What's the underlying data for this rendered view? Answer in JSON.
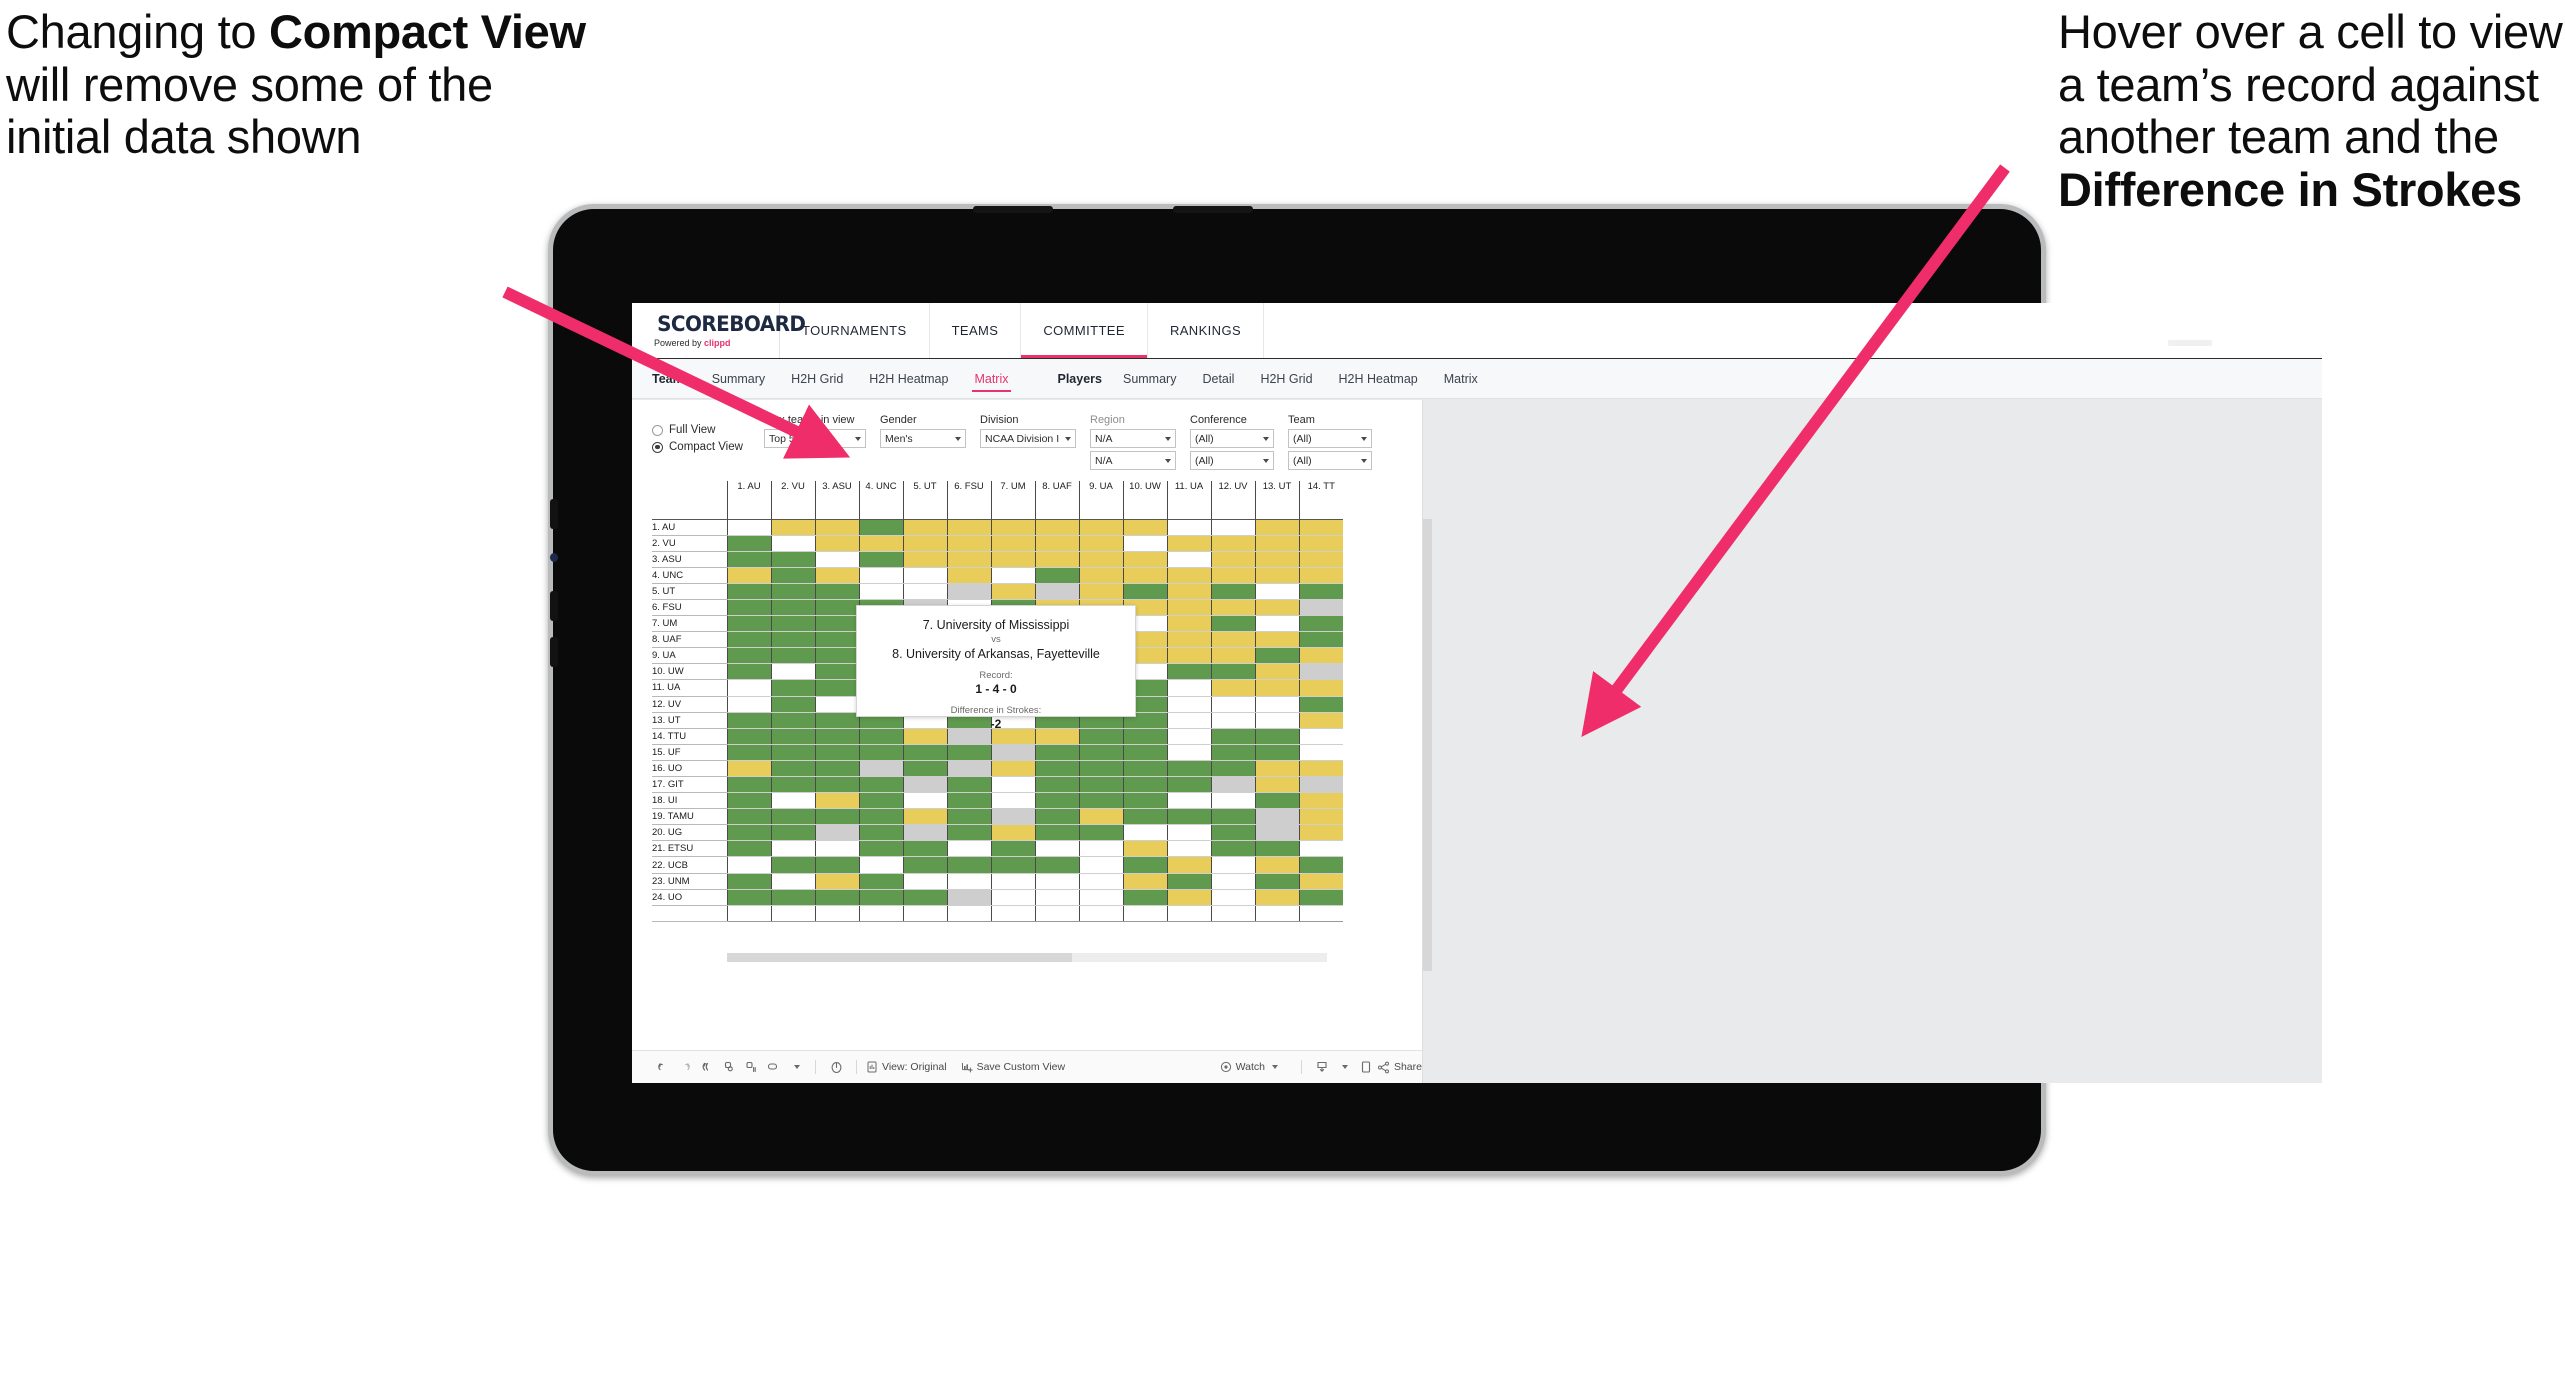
{
  "annotations": {
    "left": {
      "pre": "Changing to ",
      "bold": "Compact View",
      "post": " will remove some of the initial data shown"
    },
    "right": {
      "pre": "Hover over a cell to view a team’s record against another team and the ",
      "bold": "Difference in Strokes",
      "post": ""
    }
  },
  "app": {
    "logo": {
      "title": "SCOREBOARD",
      "sub_pre": "Powered by ",
      "sub_brand": "clippd"
    },
    "nav": [
      {
        "label": "TOURNAMENTS",
        "active": false
      },
      {
        "label": "TEAMS",
        "active": false
      },
      {
        "label": "COMMITTEE",
        "active": true
      },
      {
        "label": "RANKINGS",
        "active": false
      }
    ],
    "subnav": {
      "teams_group_label": "Teams",
      "teams_items": [
        {
          "label": "Summary",
          "active": false
        },
        {
          "label": "H2H Grid",
          "active": false
        },
        {
          "label": "H2H Heatmap",
          "active": false
        },
        {
          "label": "Matrix",
          "active": true
        }
      ],
      "players_group_label": "Players",
      "players_items": [
        {
          "label": "Summary",
          "active": false
        },
        {
          "label": "Detail",
          "active": false
        },
        {
          "label": "H2H Grid",
          "active": false
        },
        {
          "label": "H2H Heatmap",
          "active": false
        },
        {
          "label": "Matrix",
          "active": false
        }
      ]
    }
  },
  "filters": {
    "view_mode": [
      {
        "label": "Full View",
        "selected": false
      },
      {
        "label": "Compact View",
        "selected": true
      }
    ],
    "selects": [
      {
        "label": "Max teams in view",
        "value": "Top 50",
        "dim": false,
        "width": "w-max"
      },
      {
        "label": "Gender",
        "value": "Men's",
        "dim": false,
        "width": "w-gen"
      },
      {
        "label": "Division",
        "value": "NCAA Division I",
        "dim": false,
        "width": "w-div"
      },
      {
        "label": "Region",
        "value": "N/A",
        "value2": "N/A",
        "dim": true,
        "width": "w-reg"
      },
      {
        "label": "Conference",
        "value": "(All)",
        "value2": "(All)",
        "dim": false,
        "width": "w-con"
      },
      {
        "label": "Team",
        "value": "(All)",
        "value2": "(All)",
        "dim": false,
        "width": "w-tea"
      }
    ]
  },
  "matrix": {
    "columns": [
      "1. AU",
      "2. VU",
      "3. ASU",
      "4. UNC",
      "5. UT",
      "6. FSU",
      "7. UM",
      "8. UAF",
      "9. UA",
      "10. UW",
      "11. UA",
      "12. UV",
      "13. UT",
      "14. TT"
    ],
    "rows": [
      {
        "label": "1. AU",
        "cells": [
          "w",
          "y",
          "y",
          "g",
          "y",
          "y",
          "y",
          "y",
          "y",
          "y",
          "w",
          "w",
          "y",
          "y"
        ]
      },
      {
        "label": "2. VU",
        "cells": [
          "g",
          "w",
          "y",
          "y",
          "y",
          "y",
          "y",
          "y",
          "y",
          "w",
          "y",
          "y",
          "y",
          "y"
        ]
      },
      {
        "label": "3. ASU",
        "cells": [
          "g",
          "g",
          "w",
          "g",
          "y",
          "y",
          "y",
          "y",
          "y",
          "y",
          "w",
          "y",
          "y",
          "y"
        ]
      },
      {
        "label": "4. UNC",
        "cells": [
          "y",
          "g",
          "y",
          "w",
          "w",
          "y",
          "w",
          "g",
          "y",
          "y",
          "y",
          "y",
          "y",
          "y"
        ]
      },
      {
        "label": "5. UT",
        "cells": [
          "g",
          "g",
          "g",
          "w",
          "w",
          "s",
          "y",
          "s",
          "y",
          "g",
          "y",
          "g",
          "w",
          "g"
        ]
      },
      {
        "label": "6. FSU",
        "cells": [
          "g",
          "g",
          "g",
          "g",
          "s",
          "w",
          "g",
          "y",
          "y",
          "y",
          "y",
          "y",
          "y",
          "s"
        ]
      },
      {
        "label": "7. UM",
        "cells": [
          "g",
          "g",
          "g",
          "w",
          "g",
          "y",
          "w",
          "g",
          "y",
          "w",
          "y",
          "g",
          "w",
          "g"
        ]
      },
      {
        "label": "8. UAF",
        "cells": [
          "g",
          "g",
          "g",
          "y",
          "s",
          "g",
          "y",
          "w",
          "y",
          "y",
          "y",
          "y",
          "y",
          "g"
        ]
      },
      {
        "label": "9. UA",
        "cells": [
          "g",
          "g",
          "g",
          "g",
          "g",
          "g",
          "g",
          "g",
          "w",
          "y",
          "y",
          "y",
          "g",
          "y"
        ]
      },
      {
        "label": "10. UW",
        "cells": [
          "g",
          "w",
          "g",
          "g",
          "y",
          "y",
          "w",
          "g",
          "y",
          "w",
          "g",
          "g",
          "y",
          "s"
        ]
      },
      {
        "label": "11. UA",
        "cells": [
          "w",
          "g",
          "g",
          "g",
          "g",
          "g",
          "g",
          "w",
          "y",
          "g",
          "w",
          "y",
          "y",
          "y"
        ]
      },
      {
        "label": "12. UV",
        "cells": [
          "w",
          "g",
          "w",
          "g",
          "y",
          "g",
          "y",
          "y",
          "y",
          "g",
          "w",
          "w",
          "w",
          "g"
        ]
      },
      {
        "label": "13. UT",
        "cells": [
          "g",
          "g",
          "g",
          "g",
          "w",
          "g",
          "w",
          "g",
          "g",
          "g",
          "w",
          "w",
          "w",
          "y"
        ]
      },
      {
        "label": "14. TTU",
        "cells": [
          "g",
          "g",
          "g",
          "g",
          "y",
          "s",
          "y",
          "y",
          "g",
          "g",
          "w",
          "g",
          "g",
          "w"
        ]
      },
      {
        "label": "15. UF",
        "cells": [
          "g",
          "g",
          "g",
          "g",
          "g",
          "g",
          "s",
          "g",
          "g",
          "g",
          "w",
          "g",
          "g",
          "w"
        ]
      },
      {
        "label": "16. UO",
        "cells": [
          "y",
          "g",
          "g",
          "s",
          "g",
          "s",
          "y",
          "g",
          "g",
          "g",
          "g",
          "g",
          "y",
          "y"
        ]
      },
      {
        "label": "17. GIT",
        "cells": [
          "g",
          "g",
          "g",
          "g",
          "s",
          "g",
          "w",
          "g",
          "g",
          "g",
          "g",
          "s",
          "y",
          "s"
        ]
      },
      {
        "label": "18. UI",
        "cells": [
          "g",
          "w",
          "y",
          "g",
          "w",
          "g",
          "w",
          "g",
          "g",
          "g",
          "w",
          "w",
          "g",
          "y"
        ]
      },
      {
        "label": "19. TAMU",
        "cells": [
          "g",
          "g",
          "g",
          "g",
          "y",
          "g",
          "s",
          "g",
          "y",
          "g",
          "g",
          "g",
          "s",
          "y"
        ]
      },
      {
        "label": "20. UG",
        "cells": [
          "g",
          "g",
          "s",
          "g",
          "s",
          "g",
          "y",
          "g",
          "g",
          "w",
          "w",
          "g",
          "s",
          "y"
        ]
      },
      {
        "label": "21. ETSU",
        "cells": [
          "g",
          "w",
          "w",
          "g",
          "g",
          "w",
          "g",
          "w",
          "w",
          "y",
          "w",
          "g",
          "g",
          "w"
        ]
      },
      {
        "label": "22. UCB",
        "cells": [
          "w",
          "g",
          "g",
          "w",
          "g",
          "g",
          "g",
          "g",
          "w",
          "g",
          "y",
          "w",
          "y",
          "g"
        ]
      },
      {
        "label": "23. UNM",
        "cells": [
          "g",
          "w",
          "y",
          "g",
          "w",
          "w",
          "w",
          "w",
          "w",
          "y",
          "g",
          "w",
          "g",
          "y"
        ]
      },
      {
        "label": "24. UO",
        "cells": [
          "g",
          "g",
          "g",
          "g",
          "g",
          "s",
          "w",
          "w",
          "w",
          "g",
          "y",
          "w",
          "y",
          "g"
        ]
      }
    ],
    "selected_cell": {
      "row": 7,
      "col": 7
    }
  },
  "tooltip": {
    "team_a": "7. University of Mississippi",
    "vs": "vs",
    "team_b": "8. University of Arkansas, Fayetteville",
    "record_label": "Record:",
    "record_value": "1 - 4 - 0",
    "strokes_label": "Difference in Strokes:",
    "strokes_value": "-2"
  },
  "toolbar": {
    "icons": [
      "undo-icon",
      "redo-icon",
      "revert-icon",
      "refresh-icon",
      "pause-icon",
      "layout-icon"
    ],
    "view_label": "View: Original",
    "save_label": "Save Custom View",
    "watch_label": "Watch",
    "share_label": "Share"
  },
  "colors": {
    "accent": "#e8336d",
    "green": "#5f9a4e",
    "yellow": "#e8cd5b",
    "gray_cell": "#cecece",
    "arrow": "#ef2d6b"
  }
}
